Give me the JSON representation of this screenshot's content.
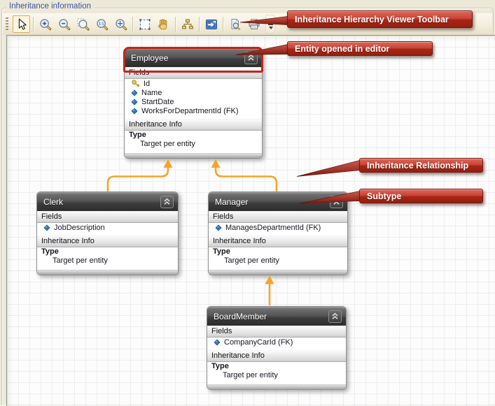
{
  "panel": {
    "title": "Inheritance information"
  },
  "toolbar": {
    "tools": [
      {
        "name": "pointer",
        "selected": true
      },
      {
        "name": "zoom in",
        "selected": false
      },
      {
        "name": "zoom out",
        "selected": false
      },
      {
        "name": "zoom to region",
        "selected": false
      },
      {
        "name": "zoom actual size",
        "selected": false
      },
      {
        "name": "zoom to fit",
        "selected": false
      },
      {
        "name": "marquee selection",
        "selected": false
      },
      {
        "name": "pan",
        "selected": false
      },
      {
        "name": "auto layout hierarchy",
        "selected": false
      },
      {
        "name": "export to image",
        "selected": false
      },
      {
        "name": "print preview",
        "selected": false
      },
      {
        "name": "print",
        "selected": false
      }
    ],
    "overflow_name": "toolbar options"
  },
  "entity_labels": {
    "fields": "Fields",
    "inheritance": "Inheritance Info",
    "type": "Type"
  },
  "entities": [
    {
      "name": "Employee",
      "highlighted": true,
      "type_value": "Target per entity",
      "fields": [
        {
          "name": "Id",
          "key": true
        },
        {
          "name": "Name",
          "key": false
        },
        {
          "name": "StartDate",
          "key": false
        },
        {
          "name": "WorksForDepartmentId (FK)",
          "key": false
        }
      ]
    },
    {
      "name": "Clerk",
      "highlighted": false,
      "type_value": "Target per entity",
      "fields": [
        {
          "name": "JobDescription",
          "key": false
        }
      ]
    },
    {
      "name": "Manager",
      "highlighted": false,
      "type_value": "Target per entity",
      "fields": [
        {
          "name": "ManagesDepartmentId (FK)",
          "key": false
        }
      ]
    },
    {
      "name": "BoardMember",
      "highlighted": false,
      "type_value": "Target per entity",
      "fields": [
        {
          "name": "CompanyCarId (FK)",
          "key": false
        }
      ]
    }
  ],
  "callouts": [
    {
      "label": "Inheritance Hierarchy Viewer Toolbar"
    },
    {
      "label": "Entity opened in editor"
    },
    {
      "label": "Inheritance Relationship"
    },
    {
      "label": "Subtype"
    }
  ],
  "colors": {
    "callout_red": "#C0392B",
    "relationship_arrow_orange": "#F5A42A",
    "entity_highlight_red": "#C3241C",
    "groupbox_title_blue": "#3B53A0"
  }
}
